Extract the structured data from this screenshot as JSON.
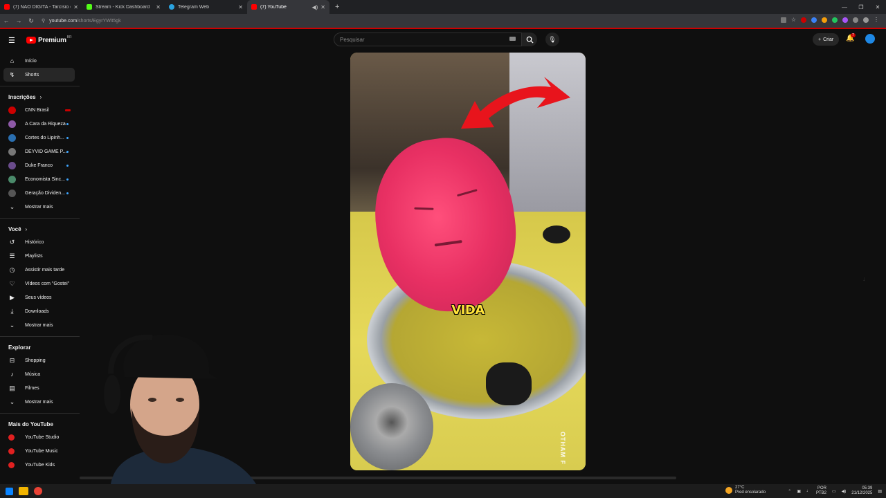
{
  "browser": {
    "tabs": [
      {
        "title": "(7) NÃO DIGITA - Tarcísio do A",
        "favicon_color": "#ff0000"
      },
      {
        "title": "Stream - Kick Dashboard",
        "favicon_color": "#53fc18"
      },
      {
        "title": "Telegram Web",
        "favicon_color": "#2aa3e0"
      },
      {
        "title": "(7) YouTube",
        "favicon_color": "#ff0000"
      }
    ],
    "url_host": "youtube.com",
    "url_path": "/shorts/EgyrYWit5gk"
  },
  "header": {
    "logo_text": "Premium",
    "logo_badge": "BR",
    "search_placeholder": "Pesquisar",
    "create_label": "Criar",
    "notification_count": "7"
  },
  "sidebar": {
    "main": [
      {
        "label": "Início",
        "icon": "home-icon",
        "glyph": "⌂"
      },
      {
        "label": "Shorts",
        "icon": "shorts-icon",
        "glyph": "↯",
        "active": true
      }
    ],
    "subscriptions_title": "Inscrições",
    "subscriptions": [
      {
        "label": "CNN Brasil",
        "color": "#cc0000",
        "live": true
      },
      {
        "label": "A Cara da Riqueza",
        "color": "#8e5aa8"
      },
      {
        "label": "Cortes do Lipinh...",
        "color": "#2a6fb0"
      },
      {
        "label": "DEYVID GAME P...",
        "color": "#777777"
      },
      {
        "label": "Duke Franco",
        "color": "#6a4c8c"
      },
      {
        "label": "Economista Sinc...",
        "color": "#4a8a6a"
      },
      {
        "label": "Geração Dividen...",
        "color": "#555555"
      }
    ],
    "show_more": "Mostrar mais",
    "you_title": "Você",
    "you": [
      {
        "label": "Histórico",
        "icon": "history-icon",
        "glyph": "↺"
      },
      {
        "label": "Playlists",
        "icon": "playlist-icon",
        "glyph": "☰"
      },
      {
        "label": "Assistir mais tarde",
        "icon": "watch-later-icon",
        "glyph": "◷"
      },
      {
        "label": "Vídeos com \"Gostei\"",
        "icon": "like-icon",
        "glyph": "♡"
      },
      {
        "label": "Seus vídeos",
        "icon": "your-videos-icon",
        "glyph": "▶"
      },
      {
        "label": "Downloads",
        "icon": "download-icon",
        "glyph": "⤓"
      }
    ],
    "explore_title": "Explorar",
    "explore": [
      {
        "label": "Shopping",
        "icon": "shopping-icon",
        "glyph": "⊟"
      },
      {
        "label": "Música",
        "icon": "music-icon",
        "glyph": "♪"
      },
      {
        "label": "Filmes",
        "icon": "movies-icon",
        "glyph": "▤"
      }
    ],
    "more_title": "Mais do YouTube",
    "more": [
      {
        "label": "YouTube Studio"
      },
      {
        "label": "YouTube Music"
      },
      {
        "label": "YouTube Kids"
      }
    ]
  },
  "short": {
    "caption": "VIDA",
    "watermark": "OTHAM F"
  },
  "taskbar": {
    "weather_temp": "27°C",
    "weather_desc": "Pred ensolarado",
    "lang_top": "POR",
    "lang_bottom": "PTB2",
    "time": "05:39",
    "date": "21/12/2025"
  }
}
